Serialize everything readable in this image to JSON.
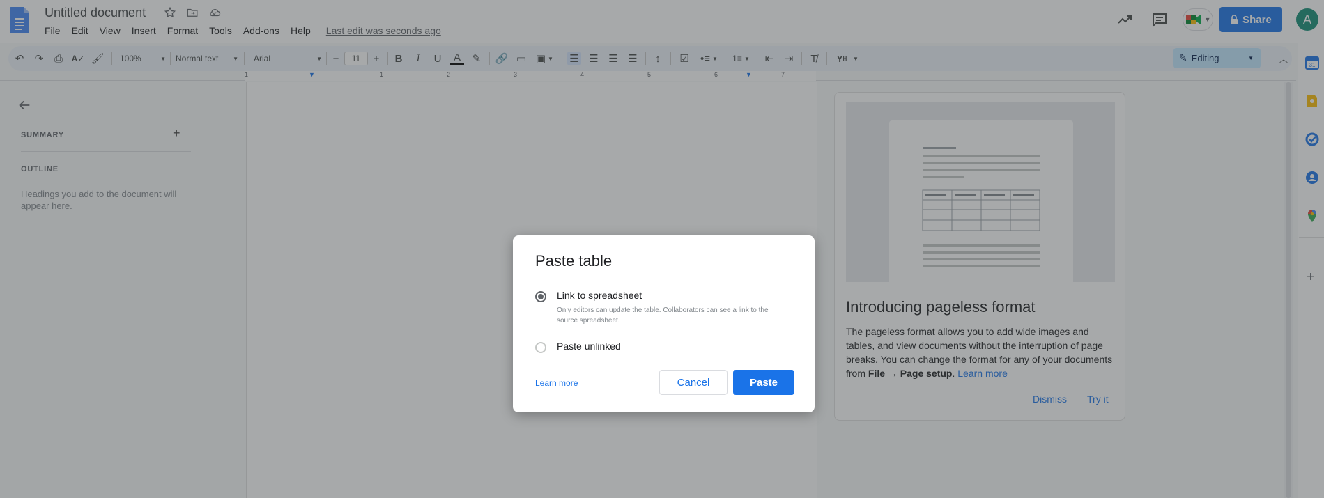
{
  "doc": {
    "title": "Untitled document",
    "last_edit": "Last edit was seconds ago"
  },
  "menu": [
    "File",
    "Edit",
    "View",
    "Insert",
    "Format",
    "Tools",
    "Add-ons",
    "Help"
  ],
  "header": {
    "share_label": "Share",
    "avatar_initial": "A"
  },
  "toolbar": {
    "zoom": "100%",
    "style": "Normal text",
    "font": "Arial",
    "font_size": "11",
    "mode": "Editing"
  },
  "ruler": {
    "ticks": [
      "1",
      "1",
      "2",
      "3",
      "4",
      "5",
      "6",
      "7"
    ]
  },
  "outline_panel": {
    "summary_label": "SUMMARY",
    "outline_label": "OUTLINE",
    "hint": "Headings you add to the document will appear here."
  },
  "promo": {
    "title": "Introducing pageless format",
    "body_1": "The pageless format allows you to add wide images and tables, and view documents without the interruption of page breaks. You can change the format for any of your documents from ",
    "body_bold": "File → Page setup",
    "body_2": ". ",
    "link": "Learn more",
    "dismiss": "Dismiss",
    "try_it": "Try it"
  },
  "dialog": {
    "title": "Paste table",
    "option_1_label": "Link to spreadsheet",
    "option_1_desc": "Only editors can update the table. Collaborators can see a link to the source spreadsheet.",
    "option_2_label": "Paste unlinked",
    "learn_more": "Learn more",
    "cancel": "Cancel",
    "paste": "Paste",
    "selected_option": "Link to spreadsheet"
  },
  "colors": {
    "accent": "#1a73e8",
    "avatar": "#138d75",
    "editing_pill": "#c2e7ff"
  }
}
